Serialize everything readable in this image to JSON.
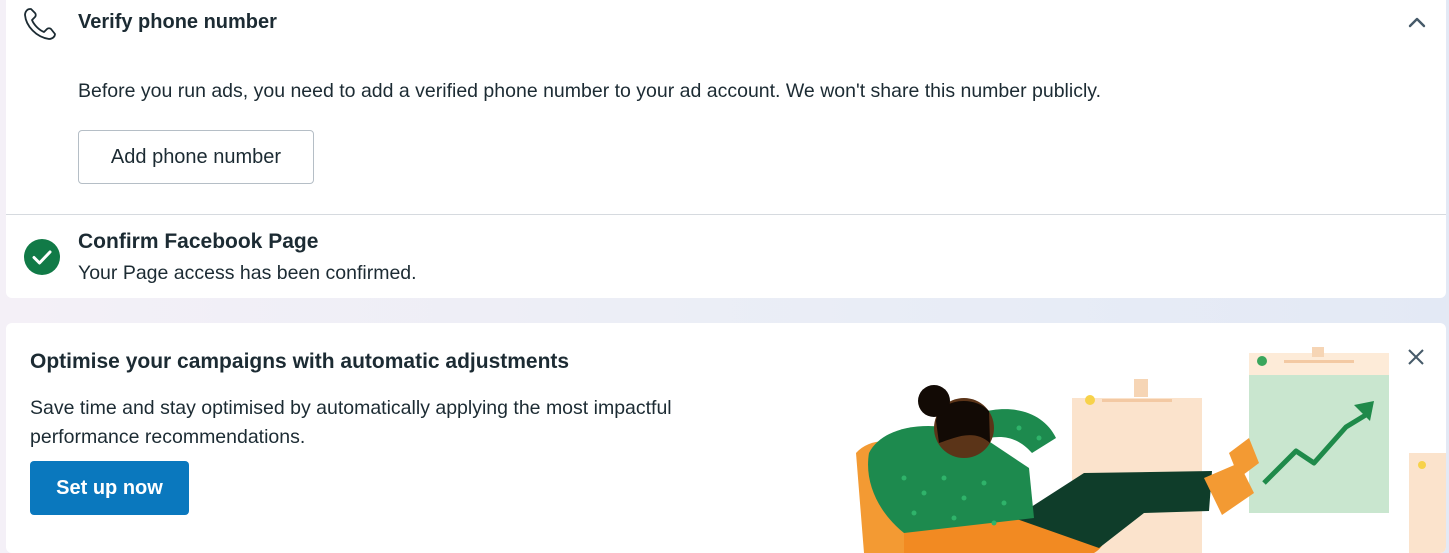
{
  "phone_section": {
    "title": "Verify phone number",
    "description": "Before you run ads, you need to add a verified phone number to your ad account. We won't share this number publicly.",
    "add_button_label": "Add phone number",
    "icon": "phone-icon",
    "collapse_icon": "chevron-up-icon"
  },
  "page_section": {
    "title": "Confirm Facebook Page",
    "status": "Your Page access has been confirmed.",
    "icon": "check-circle-icon",
    "status_color": "#117a47"
  },
  "promo": {
    "title": "Optimise your campaigns with automatic adjustments",
    "description": "Save time and stay optimised by automatically applying the most impactful performance recommendations.",
    "cta_label": "Set up now",
    "cta_color": "#0a78be",
    "close_icon": "close-icon"
  }
}
